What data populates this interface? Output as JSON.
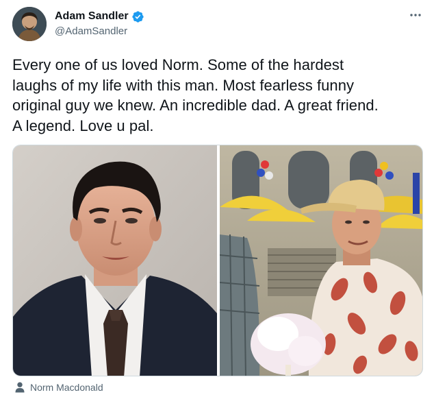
{
  "author": {
    "display_name": "Adam Sandler",
    "handle": "@AdamSandler",
    "verified": true,
    "avatar_icon": "profile-photo"
  },
  "menu": {
    "icon": "more-horizontal-icon"
  },
  "tweet": {
    "text_lines": [
      "Every one of us loved Norm. Some of the hardest",
      "laughs of my life with this man. Most fearless funny",
      "original guy we knew. An incredible dad. A great friend.",
      "A legend. Love u pal."
    ]
  },
  "media": {
    "photo_count": 2,
    "photos": [
      {
        "subject": "man-in-suit-portrait"
      },
      {
        "subject": "man-in-cap-with-cotton-candy"
      }
    ]
  },
  "tags": {
    "icon": "person-icon",
    "tagged_user": "Norm Macdonald"
  },
  "colors": {
    "text_primary": "#0f1419",
    "text_secondary": "#536471",
    "verified_blue": "#1d9bf0",
    "border": "#cfd9de"
  }
}
